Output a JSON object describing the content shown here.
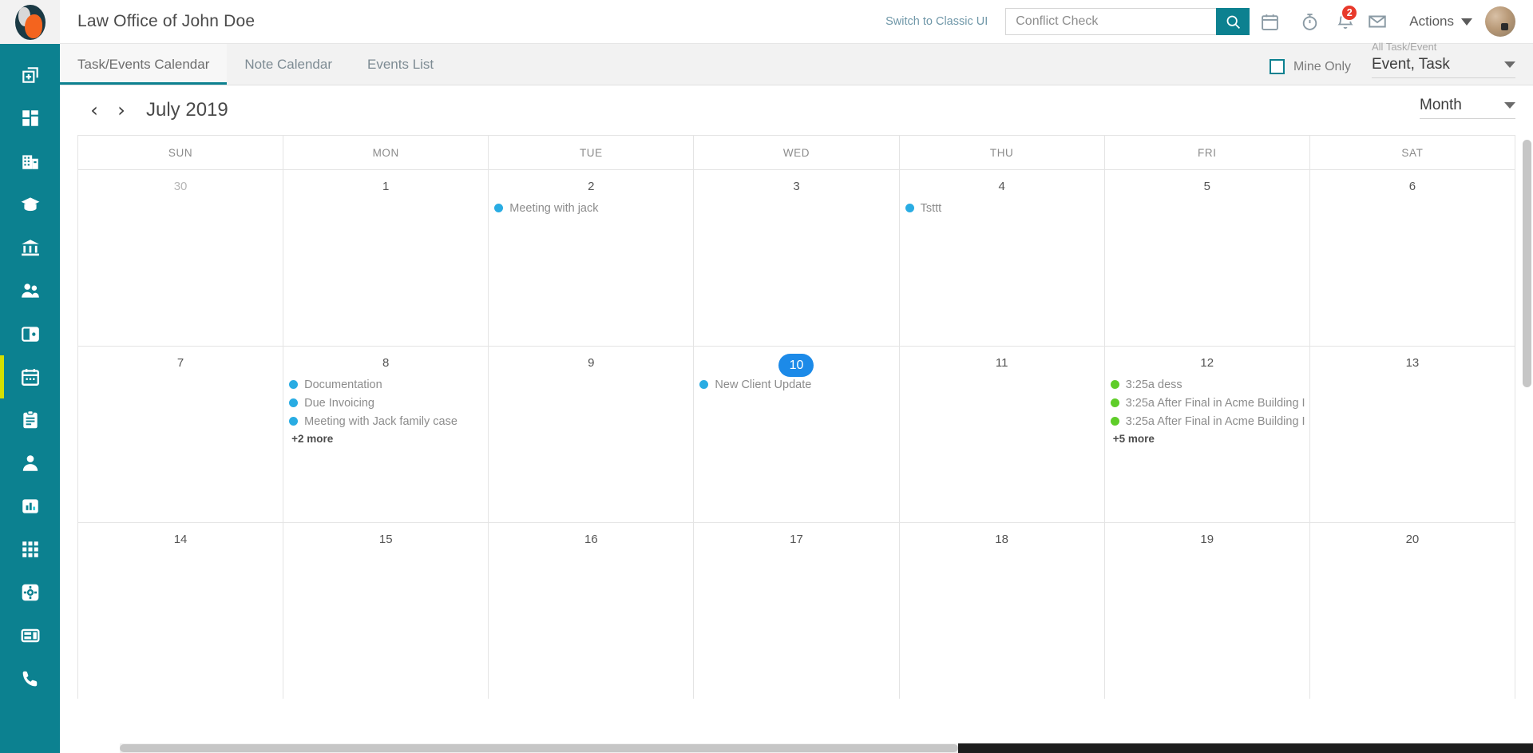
{
  "header": {
    "org_title": "Law Office of John Doe",
    "classic_ui_link": "Switch to Classic UI",
    "search_placeholder": "Conflict Check",
    "search_value": "",
    "search_icon": "search-icon",
    "calendar_icon": "calendar-icon",
    "timer_icon": "stopwatch-icon",
    "bell_icon": "bell-icon",
    "bell_badge": "2",
    "mail_icon": "envelope-icon",
    "actions_label": "Actions",
    "avatar_icon": "user-avatar"
  },
  "sidebar": {
    "logo": "company-logo",
    "items": [
      {
        "name": "add-new-icon"
      },
      {
        "name": "dashboard-icon"
      },
      {
        "name": "building-icon"
      },
      {
        "name": "graduation-cap-icon"
      },
      {
        "name": "bank-icon"
      },
      {
        "name": "people-icon"
      },
      {
        "name": "wallet-icon"
      },
      {
        "name": "calendar-icon",
        "active": true
      },
      {
        "name": "clipboard-icon"
      },
      {
        "name": "person-icon"
      },
      {
        "name": "bar-chart-icon"
      },
      {
        "name": "apps-grid-icon"
      },
      {
        "name": "settings-gear-icon"
      },
      {
        "name": "layout-panel-icon"
      },
      {
        "name": "phone-icon"
      }
    ]
  },
  "tabs": [
    {
      "label": "Task/Events Calendar",
      "active": true
    },
    {
      "label": "Note Calendar",
      "active": false
    },
    {
      "label": "Events List",
      "active": false
    }
  ],
  "filters": {
    "mine_only_label": "Mine Only",
    "mine_only_checked": false,
    "task_event_caption": "All Task/Event",
    "task_event_value": "Event, Task",
    "view_value": "Month"
  },
  "calendar": {
    "prev_label": "‹",
    "next_label": "›",
    "title": "July 2019",
    "day_headers": [
      "SUN",
      "MON",
      "TUE",
      "WED",
      "THU",
      "FRI",
      "SAT"
    ],
    "colors": {
      "event_blue": "#29ace3",
      "event_green": "#5fcd29",
      "today_badge": "#1c8ae8",
      "brand_teal": "#0c8190",
      "accent_yellow": "#d4e000",
      "badge_red": "#e8392b"
    },
    "weeks": [
      {
        "days": [
          {
            "num": "30",
            "muted": true,
            "today": false,
            "events": [],
            "more": ""
          },
          {
            "num": "1",
            "muted": false,
            "today": false,
            "events": [],
            "more": ""
          },
          {
            "num": "2",
            "muted": false,
            "today": false,
            "events": [
              {
                "title": "Meeting with jack",
                "color": "#29ace3"
              }
            ],
            "more": ""
          },
          {
            "num": "3",
            "muted": false,
            "today": false,
            "events": [],
            "more": ""
          },
          {
            "num": "4",
            "muted": false,
            "today": false,
            "events": [
              {
                "title": "Tsttt",
                "color": "#29ace3"
              }
            ],
            "more": ""
          },
          {
            "num": "5",
            "muted": false,
            "today": false,
            "events": [],
            "more": ""
          },
          {
            "num": "6",
            "muted": false,
            "today": false,
            "events": [],
            "more": ""
          }
        ]
      },
      {
        "days": [
          {
            "num": "7",
            "muted": false,
            "today": false,
            "events": [],
            "more": ""
          },
          {
            "num": "8",
            "muted": false,
            "today": false,
            "events": [
              {
                "title": "Documentation",
                "color": "#29ace3"
              },
              {
                "title": "Due Invoicing",
                "color": "#29ace3"
              },
              {
                "title": "Meeting with Jack family case",
                "color": "#29ace3"
              }
            ],
            "more": "+2 more"
          },
          {
            "num": "9",
            "muted": false,
            "today": false,
            "events": [],
            "more": ""
          },
          {
            "num": "10",
            "muted": false,
            "today": true,
            "events": [
              {
                "title": "New Client Update",
                "color": "#29ace3"
              }
            ],
            "more": ""
          },
          {
            "num": "11",
            "muted": false,
            "today": false,
            "events": [],
            "more": ""
          },
          {
            "num": "12",
            "muted": false,
            "today": false,
            "events": [
              {
                "title": "3:25a dess",
                "color": "#5fcd29"
              },
              {
                "title": "3:25a After Final in Acme Building I",
                "color": "#5fcd29"
              },
              {
                "title": "3:25a After Final in Acme Building I",
                "color": "#5fcd29"
              }
            ],
            "more": "+5 more"
          },
          {
            "num": "13",
            "muted": false,
            "today": false,
            "events": [],
            "more": ""
          }
        ]
      },
      {
        "days": [
          {
            "num": "14",
            "muted": false,
            "today": false,
            "events": [],
            "more": ""
          },
          {
            "num": "15",
            "muted": false,
            "today": false,
            "events": [],
            "more": ""
          },
          {
            "num": "16",
            "muted": false,
            "today": false,
            "events": [],
            "more": ""
          },
          {
            "num": "17",
            "muted": false,
            "today": false,
            "events": [],
            "more": ""
          },
          {
            "num": "18",
            "muted": false,
            "today": false,
            "events": [],
            "more": ""
          },
          {
            "num": "19",
            "muted": false,
            "today": false,
            "events": [],
            "more": ""
          },
          {
            "num": "20",
            "muted": false,
            "today": false,
            "events": [],
            "more": ""
          }
        ]
      }
    ]
  }
}
